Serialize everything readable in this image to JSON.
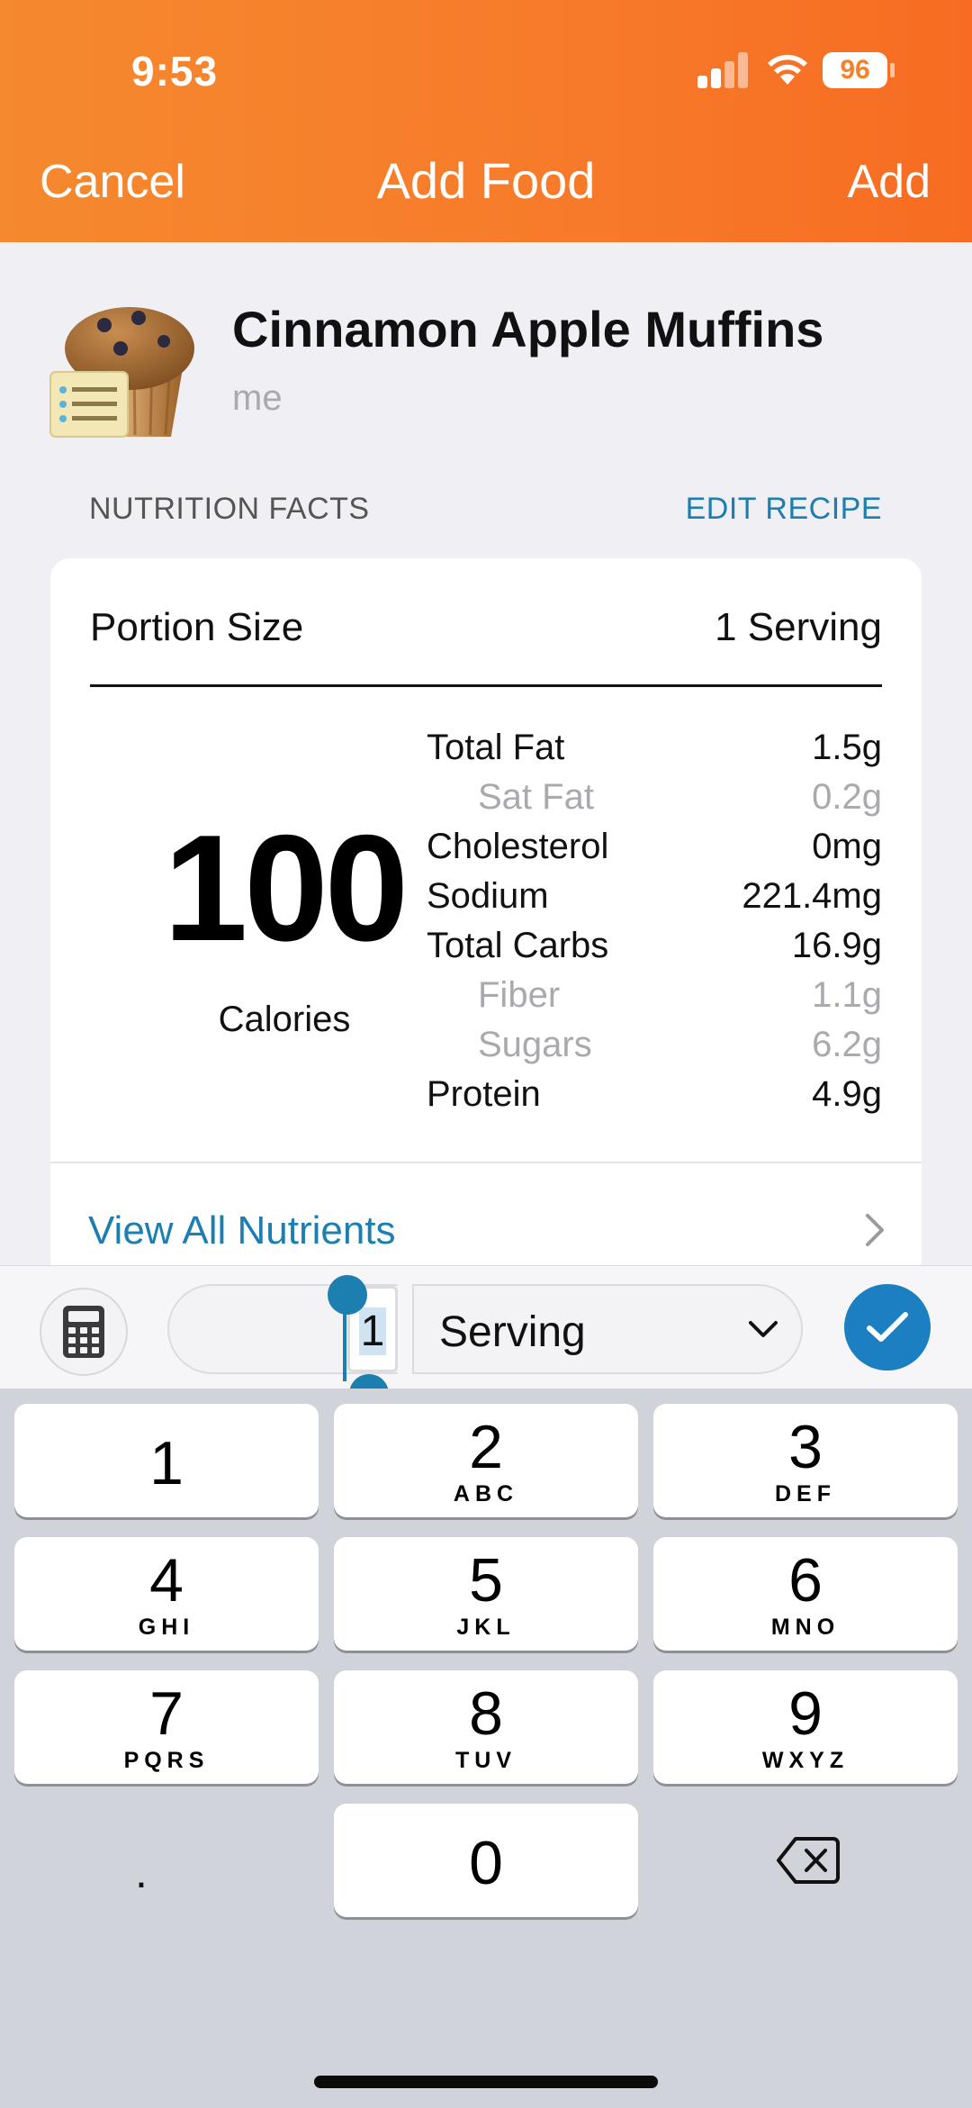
{
  "status_bar": {
    "time": "9:53",
    "battery": "96"
  },
  "nav": {
    "cancel": "Cancel",
    "title": "Add Food",
    "add": "Add"
  },
  "food": {
    "name": "Cinnamon Apple Muffins",
    "brand": "me",
    "icon": "muffin-recipe-icon"
  },
  "section": {
    "label": "NUTRITION FACTS",
    "edit": "EDIT RECIPE"
  },
  "portion": {
    "label": "Portion Size",
    "value": "1 Serving"
  },
  "calories": {
    "value": "100",
    "label": "Calories"
  },
  "nutrients": [
    {
      "label": "Total Fat",
      "value": "1.5g"
    },
    {
      "label": "Sat Fat",
      "value": "0.2g"
    },
    {
      "label": "Cholesterol",
      "value": "0mg"
    },
    {
      "label": "Sodium",
      "value": "221.4mg"
    },
    {
      "label": "Total Carbs",
      "value": "16.9g"
    },
    {
      "label": "Fiber",
      "value": "1.1g"
    },
    {
      "label": "Sugars",
      "value": "6.2g"
    },
    {
      "label": "Protein",
      "value": "4.9g"
    }
  ],
  "view_all": "View All Nutrients",
  "input": {
    "quantity": "1",
    "unit": "Serving"
  },
  "keypad": {
    "k1": {
      "num": "1",
      "letters": ""
    },
    "k2": {
      "num": "2",
      "letters": "ABC"
    },
    "k3": {
      "num": "3",
      "letters": "DEF"
    },
    "k4": {
      "num": "4",
      "letters": "GHI"
    },
    "k5": {
      "num": "5",
      "letters": "JKL"
    },
    "k6": {
      "num": "6",
      "letters": "MNO"
    },
    "k7": {
      "num": "7",
      "letters": "PQRS"
    },
    "k8": {
      "num": "8",
      "letters": "TUV"
    },
    "k9": {
      "num": "9",
      "letters": "WXYZ"
    },
    "k0": {
      "num": "0",
      "letters": ""
    },
    "dot": "."
  },
  "colors": {
    "header": "#f7802b",
    "accent": "#1d7fb0",
    "confirm": "#1b7fc1"
  }
}
